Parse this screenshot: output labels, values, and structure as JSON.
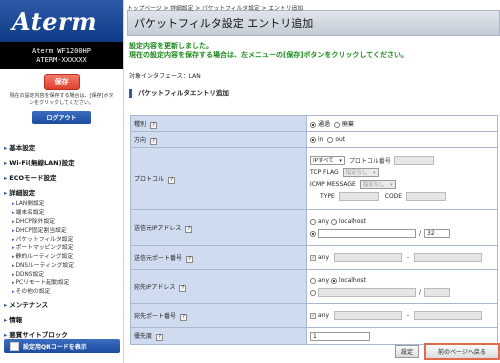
{
  "sidebar": {
    "logo": "Aterm",
    "model_line1": "Aterm WF1200HP",
    "model_line2": "ATERM-XXXXXX",
    "save_label": "保存",
    "save_note": "現在の設定内容を保存する場合は、[保存]ボタンをクリックしてください。",
    "logout_label": "ログアウト",
    "nav": [
      {
        "label": "基本設定",
        "sub": []
      },
      {
        "label": "Wi-Fi(無線LAN)設定",
        "sub": []
      },
      {
        "label": "ECOモード設定",
        "sub": []
      },
      {
        "label": "詳細設定",
        "sub": [
          "LAN側設定",
          "端末名設定",
          "DHCP除外設定",
          "DHCP固定割当設定",
          "パケットフィルタ設定",
          "ポートマッピング設定",
          "静的ルーティング設定",
          "DNSルーティング設定",
          "DDNS設定",
          "PCリモート起動設定",
          "その他の設定"
        ]
      },
      {
        "label": "メンテナンス",
        "sub": []
      },
      {
        "label": "情報",
        "sub": []
      },
      {
        "label": "悪質サイトブロック",
        "sub": []
      }
    ],
    "qr_label": "設定用QRコードを表示"
  },
  "main": {
    "breadcrumb": "トップページ > 詳細設定 > パケットフィルタ設定 > エントリ追加",
    "title": "パケットフィルタ設定 エントリ追加",
    "message_line1": "設定内容を更新しました。",
    "message_line2": "現在の設定内容を保存する場合は、左メニューの[保存]ボタンをクリックしてください。",
    "interface": "対象インタフェース：LAN",
    "section_title": "パケットフィルタエントリ追加",
    "help_glyph": "?",
    "form": {
      "type_label": "種別",
      "type_options": [
        "通過",
        "廃棄"
      ],
      "direction_label": "方向",
      "direction_options": [
        "in",
        "out"
      ],
      "protocol_label": "プロトコル",
      "protocol_select": "IPすべて",
      "protocol_number_label": "プロトコル番号",
      "tcp_flag_label": "TCP FLAG",
      "tcp_flag_select": "指定なし",
      "icmp_label": "ICMP MESSAGE",
      "icmp_select": "指定なし",
      "type_field_label": "TYPE",
      "code_field_label": "CODE",
      "src_ip_label": "送信元IPアドレス",
      "any_label": "any",
      "localhost_label": "localhost",
      "slash": "/",
      "src_prefix": "32",
      "src_port_label": "送信元ポート番号",
      "dash": "-",
      "dst_ip_label": "宛先IPアドレス",
      "dst_port_label": "宛先ポート番号",
      "priority_label": "優先度",
      "priority_value": "1"
    },
    "set_button": "設定",
    "back_button": "前のページへ戻る"
  },
  "colors": {
    "brand_blue": "#1c4c9e",
    "label_bg": "#cfdcf0",
    "message_green": "#1a8a1a",
    "back_button_border": "#e06a4e"
  }
}
